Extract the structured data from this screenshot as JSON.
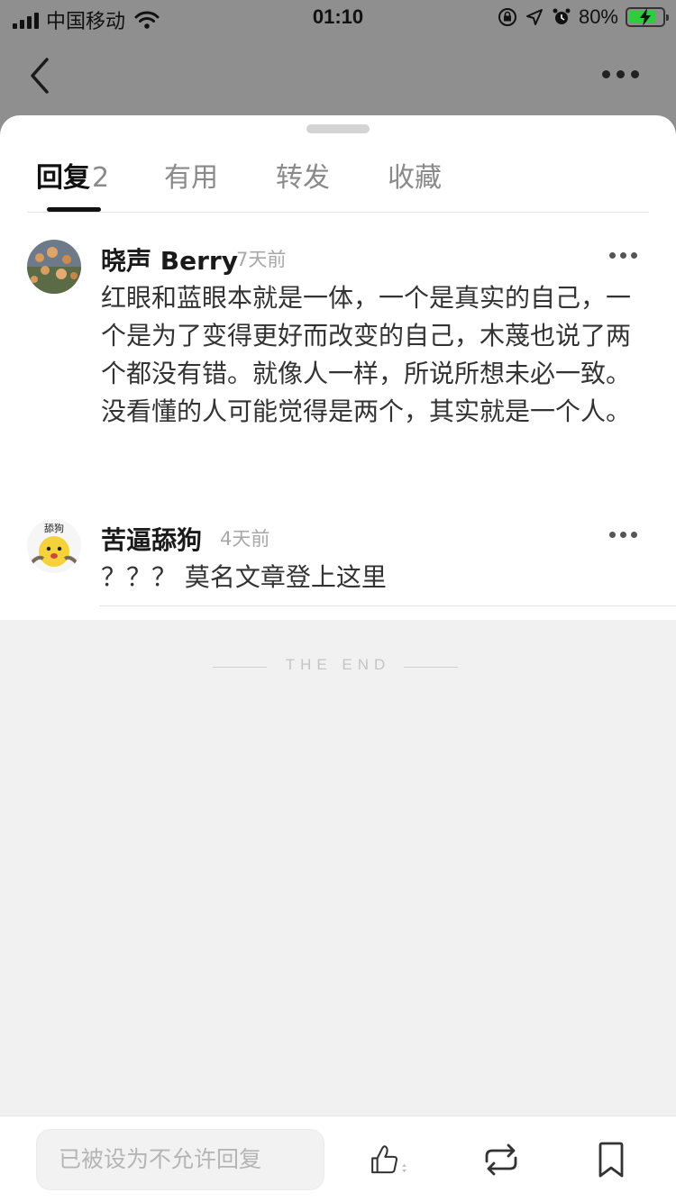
{
  "status_bar": {
    "carrier": "中国移动",
    "time": "01:10",
    "battery": "80%",
    "battery_level": 0.8
  },
  "tabs": [
    {
      "label": "回复",
      "count": "2"
    },
    {
      "label": "有用"
    },
    {
      "label": "转发"
    },
    {
      "label": "收藏"
    }
  ],
  "comments": [
    {
      "name": "晓声 Berry",
      "time": "7天前",
      "avatar": "flowers-photo",
      "text": "红眼和蓝眼本就是一体，一个是真实的自己，一个是为了变得更好而改变的自己，木蔑也说了两个都没有错。就像人一样，所说所想未必一致。没看懂的人可能觉得是两个，其实就是一个人。"
    },
    {
      "name": "苦逼舔狗",
      "time": "4天前",
      "avatar": "sticker-face",
      "avatar_text": "舔狗",
      "text": "？？？ 莫名文章登上这里"
    }
  ],
  "end_label": "THE END",
  "bottom_bar": {
    "reply_placeholder": "已被设为不允许回复"
  },
  "colors": {
    "backdrop": "#8f8f8f",
    "sheet": "#ffffff",
    "page_bg": "#f1f1f1",
    "battery_green": "#2ecc40"
  },
  "icons": [
    "back-icon",
    "more-icon",
    "like-icon",
    "repost-icon",
    "bookmark-icon"
  ]
}
